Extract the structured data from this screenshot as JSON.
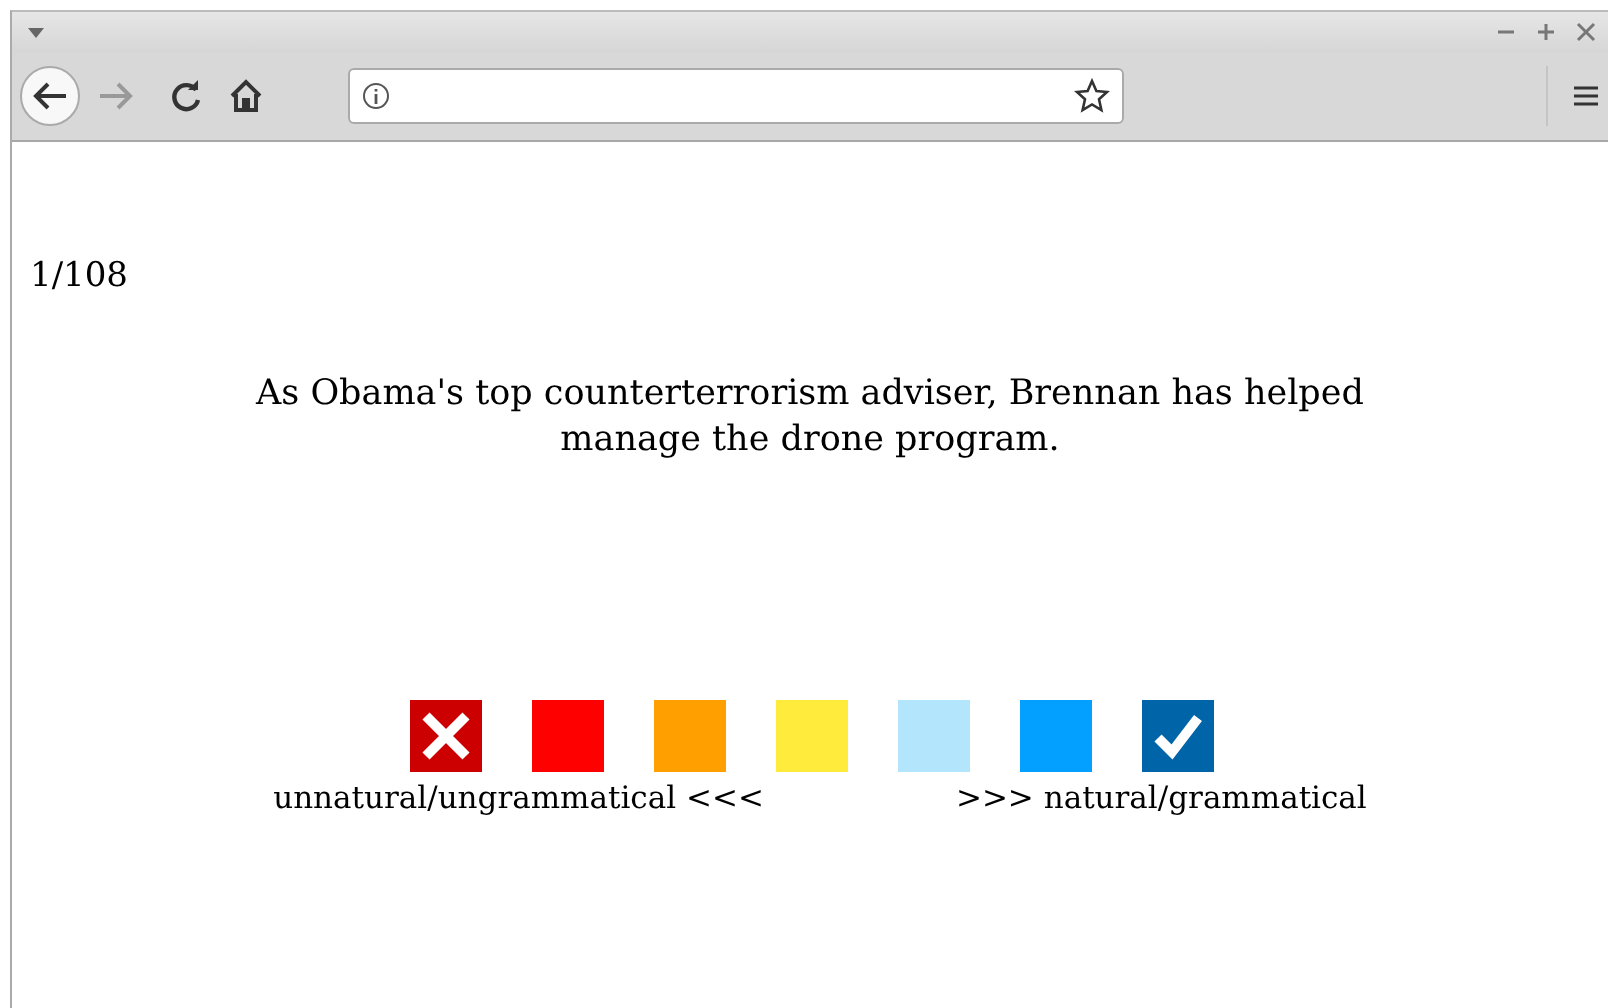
{
  "progress": "1/108",
  "sentence": "As Obama's top counterterrorism adviser, Brennan has helped manage the drone program.",
  "ratings": [
    {
      "kind": "cross",
      "color": "#cc0000"
    },
    {
      "kind": "plain",
      "color": "#ff0000"
    },
    {
      "kind": "plain",
      "color": "#ffa000"
    },
    {
      "kind": "plain",
      "color": "#ffeb3b"
    },
    {
      "kind": "plain",
      "color": "#b3e5fc"
    },
    {
      "kind": "plain",
      "color": "#03a0ff"
    },
    {
      "kind": "check",
      "color": "#0064a8"
    }
  ],
  "scale_low": "unnatural/ungrammatical <<<",
  "scale_high": ">>> natural/grammatical"
}
